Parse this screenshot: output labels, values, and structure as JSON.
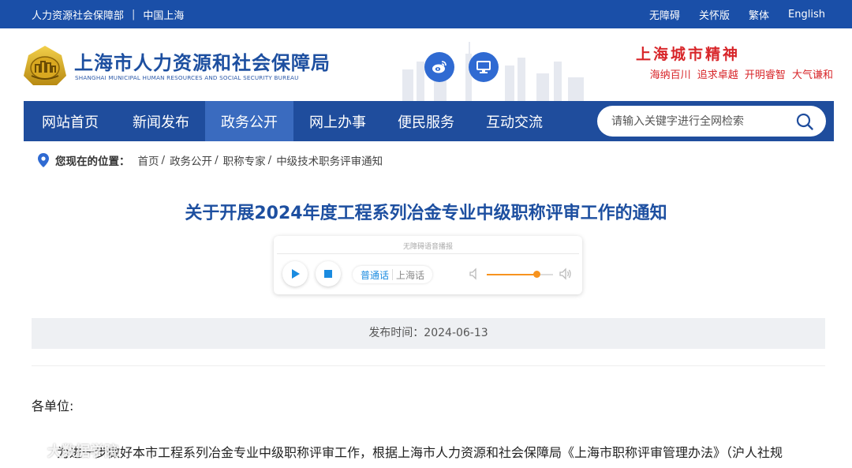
{
  "topbar": {
    "left_links": [
      "人力资源社会保障部",
      "中国上海"
    ],
    "separator": "|",
    "right_links": [
      "无障碍",
      "关怀版",
      "繁体",
      "English"
    ]
  },
  "header": {
    "logo_cn": "上海市人力资源和社会保障局",
    "logo_en": "SHANGHAI MUNICIPAL HUMAN RESOURCES AND SOCIAL SECURITY BUREAU",
    "slogan_title": "上海城市精神",
    "slogan_sub": "海纳百川 追求卓越 开明睿智 大气谦和"
  },
  "nav": {
    "items": [
      "网站首页",
      "新闻发布",
      "政务公开",
      "网上办事",
      "便民服务",
      "互动交流"
    ],
    "active_index": 2
  },
  "search": {
    "placeholder": "请输入关键字进行全网检索"
  },
  "breadcrumb": {
    "label": "您现在的位置：",
    "items": [
      "首页",
      "政务公开",
      "职称专家",
      "中级技术职务评审通知"
    ],
    "separator": "/"
  },
  "article": {
    "title": "关于开展2024年度工程系列冶金专业中级职称评审工作的通知",
    "publish": "发布时间：2024-06-13",
    "salutation": "各单位:",
    "first_paragraph": "为进一步做好本市工程系列冶金专业中级职称评审工作，根据上海市人力资源和社会保障局《上海市职称评审管理办法》（沪人社规"
  },
  "player": {
    "title": "无障碍语音播报",
    "languages": [
      "普通话",
      "上海话"
    ],
    "active_language": 0,
    "volume": 0.75
  },
  "watermark": {
    "text": "大数据学院"
  },
  "colors": {
    "brand_blue": "#1a4fa8",
    "nav_blue": "#1f4d9d",
    "nav_active": "#3a6bbf",
    "title_blue": "#1d4fa0",
    "slogan_red": "#d8262a",
    "accent_orange": "#f7931e"
  }
}
